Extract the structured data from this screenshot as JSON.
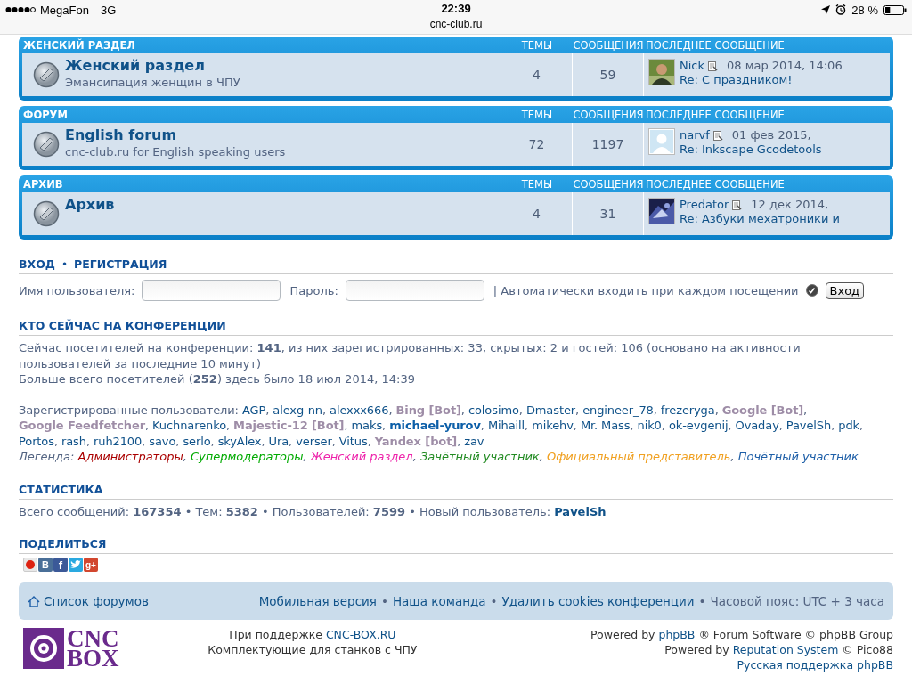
{
  "status_bar": {
    "carrier": "MegaFon",
    "network": "3G",
    "time": "22:39",
    "url": "cnc-club.ru",
    "battery": "28 %"
  },
  "forum_blocks": [
    {
      "title": "ЖЕНСКИЙ РАЗДЕЛ",
      "col_topics": "ТЕМЫ",
      "col_posts": "СООБЩЕНИЯ",
      "col_last": "ПОСЛЕДНЕЕ СООБЩЕНИЕ",
      "forum": {
        "name": "Женский раздел",
        "description": "Эмансипация женщин в ЧПУ",
        "topics": "4",
        "posts": "59",
        "last": {
          "kind": "person",
          "author": "Nick",
          "date": "08 мар 2014, 14:06",
          "subject": "Re: С праздником!"
        }
      }
    },
    {
      "title": "ФОРУМ",
      "col_topics": "ТЕМЫ",
      "col_posts": "СООБЩЕНИЯ",
      "col_last": "ПОСЛЕДНЕЕ СООБЩЕНИЕ",
      "forum": {
        "name": "English forum",
        "description": "cnc-club.ru for English speaking users",
        "topics": "72",
        "posts": "1197",
        "last": {
          "kind": "default",
          "author": "narvf",
          "date": "01 фев 2015,",
          "subject": "Re: Inkscape Gcodetools"
        }
      }
    },
    {
      "title": "АРХИВ",
      "col_topics": "ТЕМЫ",
      "col_posts": "СООБЩЕНИЯ",
      "col_last": "ПОСЛЕДНЕЕ СООБЩЕНИЕ",
      "forum": {
        "name": "Архив",
        "topics": "4",
        "posts": "31",
        "last": {
          "kind": "picture",
          "author": "Predator",
          "date": "12 дек 2014,",
          "subject": "Re: Азбуки мехатроники и"
        }
      }
    }
  ],
  "login": {
    "heading_links": [
      "ВХОД",
      "РЕГИСТРАЦИЯ"
    ],
    "heading_separator": "•",
    "username_label": "Имя пользователя:",
    "password_label": "Пароль:",
    "autologin_label": "| Автоматически входить при каждом посещении",
    "autologin_checked": true,
    "button": "Вход"
  },
  "online": {
    "heading": "КТО СЕЙЧАС НА КОНФЕРЕНЦИИ",
    "summary": "Сейчас посетителей на конференции: **141**, из них зарегистрированных: 33, скрытых: 2 и гостей: 106 (основано на активности пользователей за последние 10 минут)",
    "record": "Больше всего посетителей (**252**) здесь было 18 июл 2014, 14:39",
    "users_label": "Зарегистрированные пользователи:",
    "separator": ", ",
    "users": [
      {
        "name": "AGP",
        "kind": "user"
      },
      {
        "name": "alexg-nn",
        "kind": "user"
      },
      {
        "name": "alexxx666",
        "kind": "user"
      },
      {
        "name": "Bing [Bot]",
        "kind": "bot",
        "color": "#9e8da7"
      },
      {
        "name": "colosimo",
        "kind": "user"
      },
      {
        "name": "Dmaster",
        "kind": "user"
      },
      {
        "name": "engineer_78",
        "kind": "user"
      },
      {
        "name": "frezeryga",
        "kind": "user"
      },
      {
        "name": "Google [Bot]",
        "kind": "bot",
        "color": "#9e8da7"
      },
      {
        "name": "Google Feedfetcher",
        "kind": "bot",
        "color": "#9e8da7"
      },
      {
        "name": "Kuchnarenko",
        "kind": "user"
      },
      {
        "name": "Majestic-12 [Bot]",
        "kind": "bot",
        "color": "#9e8da7"
      },
      {
        "name": "maks",
        "kind": "user"
      },
      {
        "name": "michael-yurov",
        "kind": "staff",
        "color": "#0b5ea8"
      },
      {
        "name": "Mihaill",
        "kind": "user"
      },
      {
        "name": "mikehv",
        "kind": "user"
      },
      {
        "name": "Mr. Mass",
        "kind": "user"
      },
      {
        "name": "nik0",
        "kind": "user"
      },
      {
        "name": "ok-evgenij",
        "kind": "user"
      },
      {
        "name": "Ovaday",
        "kind": "user"
      },
      {
        "name": "PavelSh",
        "kind": "user"
      },
      {
        "name": "pdk",
        "kind": "user"
      },
      {
        "name": "Portos",
        "kind": "user"
      },
      {
        "name": "rash",
        "kind": "user"
      },
      {
        "name": "ruh2100",
        "kind": "user"
      },
      {
        "name": "savo",
        "kind": "user"
      },
      {
        "name": "serlo",
        "kind": "user"
      },
      {
        "name": "skyAlex",
        "kind": "user"
      },
      {
        "name": "Ura",
        "kind": "user"
      },
      {
        "name": "verser",
        "kind": "user"
      },
      {
        "name": "Vitus",
        "kind": "user"
      },
      {
        "name": "Yandex [bot]",
        "kind": "bot",
        "color": "#9e8da7"
      },
      {
        "name": "zav",
        "kind": "user"
      }
    ],
    "legend_label": "Легенда:",
    "legend": [
      {
        "name": "Администраторы",
        "color": "#aa0000"
      },
      {
        "name": "Супермодераторы",
        "color": "#00aa00"
      },
      {
        "name": "Женский раздел",
        "color": "#ee22aa"
      },
      {
        "name": "Зачётный участник",
        "color": "#228b22"
      },
      {
        "name": "Официальный представитель",
        "color": "#f0a020"
      },
      {
        "name": "Почётный участник",
        "color": "#1e5fa8"
      }
    ]
  },
  "statistics": {
    "heading": "СТАТИСТИКА",
    "text": "Всего сообщений: **167354** • Тем: **5382** • Пользователей: **7599** • Новый пользователь: ",
    "newest_user": "PavelSh"
  },
  "share": {
    "heading": "ПОДЕЛИТЬСЯ",
    "icons": [
      {
        "kind": "record"
      },
      {
        "kind": "vk",
        "glyph": "В"
      },
      {
        "kind": "facebook",
        "glyph": "f"
      },
      {
        "kind": "twitter"
      },
      {
        "kind": "gplus",
        "glyph": "g+"
      }
    ]
  },
  "footer_nav": {
    "home": "Список форумов",
    "links": [
      "Мобильная версия",
      "Наша команда",
      "Удалить cookies конференции"
    ],
    "separator": "•",
    "timezone": "Часовой пояс: UTC + 3 часа"
  },
  "footer": {
    "logo_top": "CNC",
    "logo_bottom": "BOX",
    "sponsor_label": "При поддержке",
    "sponsor_link": "CNC-BOX.RU",
    "sponsor_note": "Комплектующие для станков с ЧПУ",
    "powered": [
      {
        "before": "Powered by",
        "link": "phpBB",
        "after": "® Forum Software © phpBB Group"
      },
      {
        "before": "Powered by",
        "link": "Reputation System",
        "after": "© Pico88"
      },
      {
        "link": "Русская поддержка phpBB"
      }
    ]
  }
}
